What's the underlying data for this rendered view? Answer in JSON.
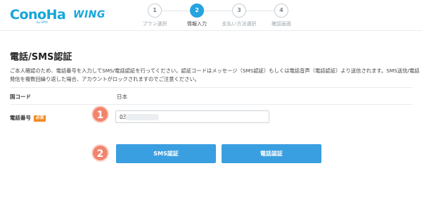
{
  "brand": {
    "logo_main": "ConoHa",
    "logo_sub": "by GMO",
    "logo_product": "WING",
    "color": "#14a6dc"
  },
  "stepper": {
    "steps": [
      {
        "number": "1",
        "label": "プラン選択",
        "state": "done"
      },
      {
        "number": "2",
        "label": "情報入力",
        "state": "active"
      },
      {
        "number": "3",
        "label": "支払い方法選択",
        "state": "pending"
      },
      {
        "number": "4",
        "label": "確認画面",
        "state": "pending"
      }
    ],
    "active_color": "#27a3df"
  },
  "page": {
    "title": "電話/SMS認証",
    "description": "ご本人確認のため、電話番号を入力してSMS/電話認証を行ってください。認証コードはメッセージ（SMS認証）もしくは電話音声（電話認証）より送信されます。SMS送信/電話発信を複数回繰り返した場合、アカウントがロックされますのでご注意ください。"
  },
  "form": {
    "country_label": "国コード",
    "country_value": "日本",
    "phone_label": "電話番号",
    "required_badge": "必須",
    "phone_value": "03-"
  },
  "buttons": {
    "sms_label": "SMS認証",
    "call_label": "電話認証",
    "color": "#3a9fe0"
  },
  "annotations": {
    "marker_1": "1",
    "marker_2": "2",
    "color": "#f2846c"
  }
}
